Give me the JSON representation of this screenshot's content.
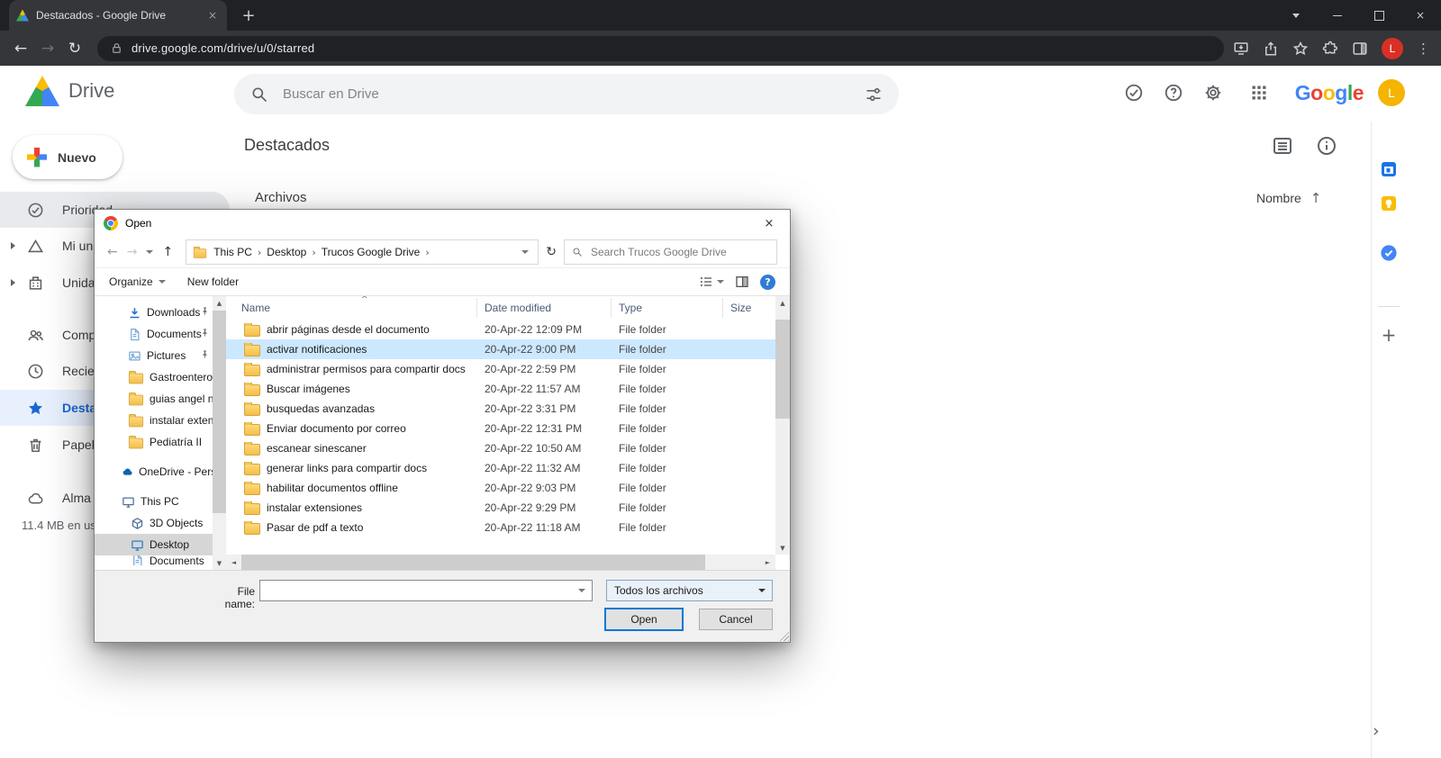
{
  "glyphs": {
    "back": "←",
    "forward": "→",
    "reload": "↻",
    "up": "↑",
    "close": "×",
    "add": "+",
    "kebab": "⋮",
    "crumb_sep": "›",
    "sort": "^",
    "question": "?",
    "scroll_up": "▲",
    "scroll_down": "▼",
    "scroll_left": "◄",
    "scroll_right": "►",
    "arrow_up": "↑",
    "chevron_right": "›"
  },
  "browser": {
    "tab_title": "Destacados - Google Drive",
    "url": "drive.google.com/drive/u/0/starred",
    "avatar_letter": "L"
  },
  "drive": {
    "brand": "Drive",
    "search_placeholder": "Buscar en Drive",
    "google_logo": "Google",
    "avatar_letter": "L",
    "new_button": "Nuevo",
    "page_title": "Destacados",
    "files_label": "Archivos",
    "sort_label": "Nombre",
    "storage_text": "11.4 MB en us",
    "sidebar_items": [
      {
        "label": "Prioridad",
        "icon": "check-circle"
      },
      {
        "label": "Mi un",
        "icon": "drive-triangle",
        "expandable": true
      },
      {
        "label": "Unida",
        "icon": "shared-drive",
        "expandable": true
      },
      {
        "label": "Comp",
        "icon": "people"
      },
      {
        "label": "Recie",
        "icon": "clock"
      },
      {
        "label": "Desta",
        "icon": "star",
        "selected": true
      },
      {
        "label": "Papel",
        "icon": "trash"
      },
      {
        "label": "Alma",
        "icon": "cloud"
      }
    ]
  },
  "dialog": {
    "title": "Open",
    "breadcrumb": [
      "This PC",
      "Desktop",
      "Trucos Google Drive"
    ],
    "search_placeholder": "Search Trucos Google Drive",
    "organize_label": "Organize",
    "new_folder_label": "New folder",
    "columns": [
      "Name",
      "Date modified",
      "Type",
      "Size"
    ],
    "tree": [
      {
        "label": "Downloads",
        "icon": "download",
        "pinned": true
      },
      {
        "label": "Documents",
        "icon": "document",
        "pinned": true
      },
      {
        "label": "Pictures",
        "icon": "picture",
        "pinned": true
      },
      {
        "label": "Gastroenterolog",
        "icon": "folder"
      },
      {
        "label": "guias angel navi",
        "icon": "folder"
      },
      {
        "label": "instalar extension",
        "icon": "folder"
      },
      {
        "label": "Pediatría II",
        "icon": "folder"
      },
      {
        "label": "OneDrive - Person",
        "icon": "onedrive-cloud"
      },
      {
        "label": "This PC",
        "icon": "computer"
      },
      {
        "label": "3D Objects",
        "icon": "cube"
      },
      {
        "label": "Desktop",
        "icon": "monitor",
        "selected": true
      },
      {
        "label": "Documents",
        "icon": "document",
        "clipped": true
      }
    ],
    "files": [
      {
        "name": "abrir páginas desde el documento",
        "date": "20-Apr-22 12:09 PM",
        "type": "File folder"
      },
      {
        "name": "activar notificaciones",
        "date": "20-Apr-22 9:00 PM",
        "type": "File folder",
        "selected": true
      },
      {
        "name": "administrar permisos para compartir docs",
        "date": "20-Apr-22 2:59 PM",
        "type": "File folder"
      },
      {
        "name": "Buscar imágenes",
        "date": "20-Apr-22 11:57 AM",
        "type": "File folder"
      },
      {
        "name": "busquedas avanzadas",
        "date": "20-Apr-22 3:31 PM",
        "type": "File folder"
      },
      {
        "name": "Enviar documento por correo",
        "date": "20-Apr-22 12:31 PM",
        "type": "File folder"
      },
      {
        "name": "escanear sinescaner",
        "date": "20-Apr-22 10:50 AM",
        "type": "File folder"
      },
      {
        "name": "generar links para compartir docs",
        "date": "20-Apr-22 11:32 AM",
        "type": "File folder"
      },
      {
        "name": "habilitar documentos offline",
        "date": "20-Apr-22 9:03 PM",
        "type": "File folder"
      },
      {
        "name": "instalar extensiones",
        "date": "20-Apr-22 9:29 PM",
        "type": "File folder"
      },
      {
        "name": "Pasar de pdf a texto",
        "date": "20-Apr-22 11:18 AM",
        "type": "File folder"
      }
    ],
    "file_name_label": "File name:",
    "file_name_value": "",
    "file_type_value": "Todos los archivos",
    "open_label": "Open",
    "cancel_label": "Cancel"
  }
}
